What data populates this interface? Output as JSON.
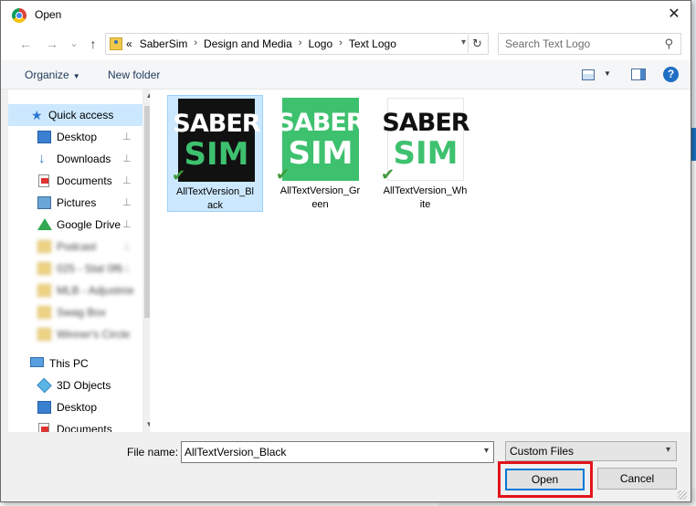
{
  "window": {
    "title": "Open",
    "close_glyph": "✕"
  },
  "navigation": {
    "back_glyph": "←",
    "forward_glyph": "→",
    "recent_glyph": "⌄",
    "up_glyph": "↑",
    "breadcrumb_prefix": "«",
    "breadcrumbs": [
      "SaberSim",
      "Design and Media",
      "Logo",
      "Text Logo"
    ],
    "refresh_glyph": "↻",
    "search_placeholder": "Search Text Logo"
  },
  "toolbar": {
    "organize_label": "Organize",
    "new_folder_label": "New folder",
    "help_glyph": "?"
  },
  "sidebar": {
    "items": [
      {
        "label": "Quick access",
        "icon": "star-icon",
        "selected": true,
        "pinned": false
      },
      {
        "label": "Desktop",
        "icon": "desktop-icon",
        "pinned": true
      },
      {
        "label": "Downloads",
        "icon": "download-icon",
        "pinned": true
      },
      {
        "label": "Documents",
        "icon": "documents-icon",
        "pinned": true
      },
      {
        "label": "Pictures",
        "icon": "pictures-icon",
        "pinned": true
      },
      {
        "label": "Google Drive",
        "icon": "google-drive-icon",
        "pinned": true
      },
      {
        "label": "Podcast",
        "icon": "folder-icon",
        "pinned": true,
        "blurred": true
      },
      {
        "label": "025 - Stat 0f6",
        "icon": "folder-icon",
        "pinned": true,
        "blurred": true
      },
      {
        "label": "MLB - Adjustme",
        "icon": "folder-icon",
        "pinned": true,
        "blurred": true
      },
      {
        "label": "Swag Box",
        "icon": "folder-icon",
        "pinned": false,
        "blurred": true
      },
      {
        "label": "Winner's Circle",
        "icon": "folder-icon",
        "pinned": false,
        "blurred": true
      }
    ],
    "this_pc": {
      "label": "This PC",
      "icon": "computer-icon"
    },
    "this_pc_items": [
      {
        "label": "3D Objects",
        "icon": "3d-objects-icon"
      },
      {
        "label": "Desktop",
        "icon": "desktop-icon"
      },
      {
        "label": "Documents",
        "icon": "documents-icon"
      }
    ],
    "pin_glyph": "📌"
  },
  "files": [
    {
      "name": "AllTextVersion_Black",
      "line1": "SABER",
      "line2": "SIM",
      "bg": "#111111",
      "line1_color": "#ffffff",
      "line2_color": "#3ec16f",
      "selected": true
    },
    {
      "name": "AllTextVersion_Green",
      "line1": "SABER",
      "line2": "SIM",
      "bg": "#3ec16f",
      "line1_color": "#ffffff",
      "line2_color": "#ffffff",
      "selected": false
    },
    {
      "name": "AllTextVersion_White",
      "line1": "SABER",
      "line2": "SIM",
      "bg": "#ffffff",
      "line1_color": "#111111",
      "line2_color": "#3ec16f",
      "selected": false
    }
  ],
  "sync_check_glyph": "✔",
  "bottom": {
    "file_name_label": "File name:",
    "file_name_value": "AllTextVersion_Black",
    "file_type_value": "Custom Files",
    "open_label": "Open",
    "cancel_label": "Cancel"
  },
  "colors": {
    "accent": "#0078d7",
    "highlight": "#e3141b",
    "selection": "#cce8ff"
  }
}
